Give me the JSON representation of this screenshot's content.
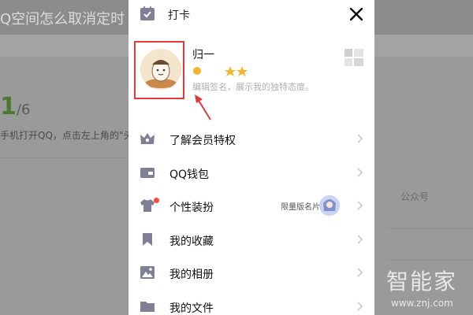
{
  "background": {
    "title": "Q空间怎么取消定时",
    "step_number": "1",
    "step_total": "/6",
    "step_text": "手机打开QQ，点击左上角的\"头",
    "right_text": "公众号"
  },
  "drawer": {
    "checkin_label": "打卡",
    "checkin_icon": "calendar-check-icon",
    "close_icon": "close-icon",
    "profile": {
      "username": "归一",
      "signature": "编辑签名，展示我的独特态度。",
      "qr_icon": "qr-code-icon"
    },
    "menu": [
      {
        "label": "了解会员特权",
        "icon": "crown-icon"
      },
      {
        "label": "QQ钱包",
        "icon": "wallet-icon"
      },
      {
        "label": "个性装扮",
        "icon": "shirt-icon",
        "extra": "限量版名片",
        "badge": true
      },
      {
        "label": "我的收藏",
        "icon": "bookmark-icon"
      },
      {
        "label": "我的相册",
        "icon": "photo-icon"
      },
      {
        "label": "我的文件",
        "icon": "folder-icon"
      }
    ]
  },
  "watermark": {
    "text": "智能家",
    "url": "www.znj.com"
  },
  "colors": {
    "accent_gray": "#555555",
    "highlight_red": "#e23a3a",
    "badge_red": "#ff4a3a",
    "level_gold": "#f2b530"
  }
}
